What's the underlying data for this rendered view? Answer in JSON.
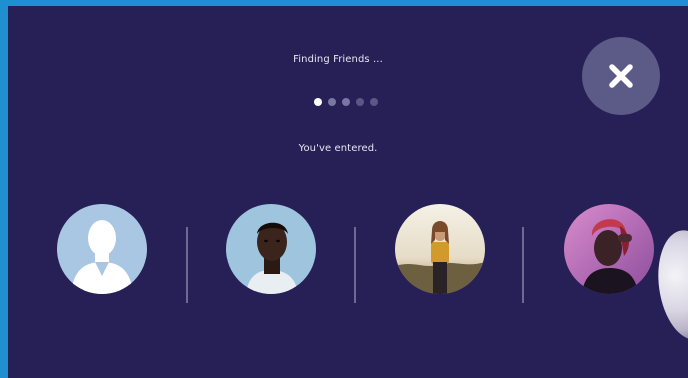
{
  "status": {
    "finding_text": "Finding Friends ...",
    "entered_text": "You've entered."
  },
  "progress": {
    "total_dots": 5,
    "active_index": 0
  },
  "close_button": {
    "icon": "close-icon"
  },
  "friends": [
    {
      "avatar": "default-user-avatar-icon",
      "color": "#a9c7e3"
    },
    {
      "avatar": "profile-photo",
      "color": "#9fc4dd"
    },
    {
      "avatar": "profile-photo",
      "color": "#f0ece2"
    },
    {
      "avatar": "profile-photo",
      "color": "#c27cb8"
    }
  ],
  "colors": {
    "background": "#262056",
    "outer_frame": "#1f8fd0",
    "close_button_bg": "#5c5a87"
  }
}
